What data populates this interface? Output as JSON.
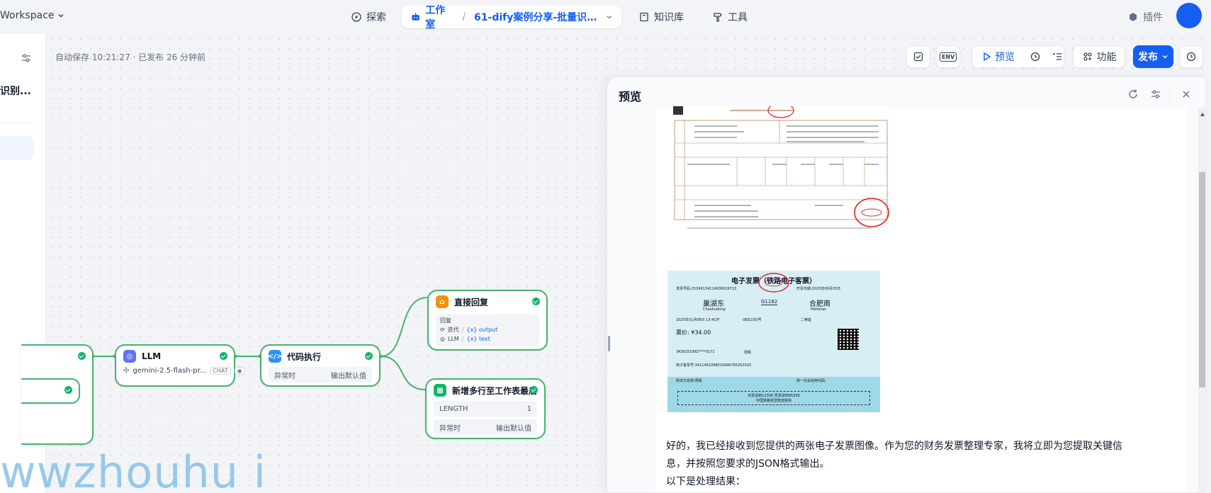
{
  "topbar": {
    "workspace": "Workspace",
    "nav": {
      "explore": "探索",
      "studio": "工作室",
      "app_name": "61-dify案例分享-批量识别...",
      "knowledge": "知识库",
      "tools": "工具",
      "plugins": "插件"
    }
  },
  "sidebar": {
    "app_short": "识别..."
  },
  "canvas": {
    "save_status": "自动保存 10:21:27 · 已发布 26 分钟前",
    "toolbar": {
      "env": "ENV",
      "preview": "预览",
      "features": "功能",
      "publish": "发布"
    }
  },
  "nodes": {
    "llm": {
      "title": "LLM",
      "model": "gemini-2.5-flash-pr...",
      "mode": "CHAT"
    },
    "code": {
      "title": "代码执行",
      "exception_label": "异常时",
      "exception_value": "输出默认值"
    },
    "answer": {
      "title": "直接回复",
      "field": "回复",
      "var1_src": "迭代",
      "var1": "{x} output",
      "var2_src": "LLM",
      "var2": "{x} text"
    },
    "sheet": {
      "title": "新增多行至工作表最后",
      "length_label": "LENGTH",
      "length_value": "1",
      "exception_label": "异常时",
      "exception_value": "输出默认值"
    }
  },
  "preview": {
    "title": "预览",
    "invoice2": {
      "title": "电子发票（铁路电子客票）",
      "number_label": "发票号码:25349134114000026713",
      "date": "开票日期:2025年06月05日",
      "from_station": "巢湖东",
      "from_pinyin": "Chaohudong",
      "train": "G1182",
      "to_station": "合肥南",
      "to_pinyin": "Hefeinan",
      "depart": "2025年01月08日  13:41开",
      "seat": "08车10D号",
      "class": "二等座",
      "price": "票价: ¥34.00",
      "id": "3426251992****0171",
      "name": "周辉",
      "ticket_no": "电子客票号:3411461098010996765252025",
      "buyer": "购买方名称:周辉",
      "credit_code": "统一社会信用代码:",
      "notice1": "买票请到12306 发货请到95306",
      "notice2": "中国铁路祝您旅途愉快"
    },
    "response": [
      "好的，我已经接收到您提供的两张电子发票图像。作为您的财务发票整理专家，我将立即为您提取关键信",
      "息，并按照您要求的JSON格式输出。",
      "以下是处理结果："
    ]
  },
  "watermark": "wwzhouhu i",
  "colors": {
    "accent": "#155eef",
    "success": "#17b26a",
    "node_border": "#47b26e",
    "watermark": "#8fc4e8"
  }
}
